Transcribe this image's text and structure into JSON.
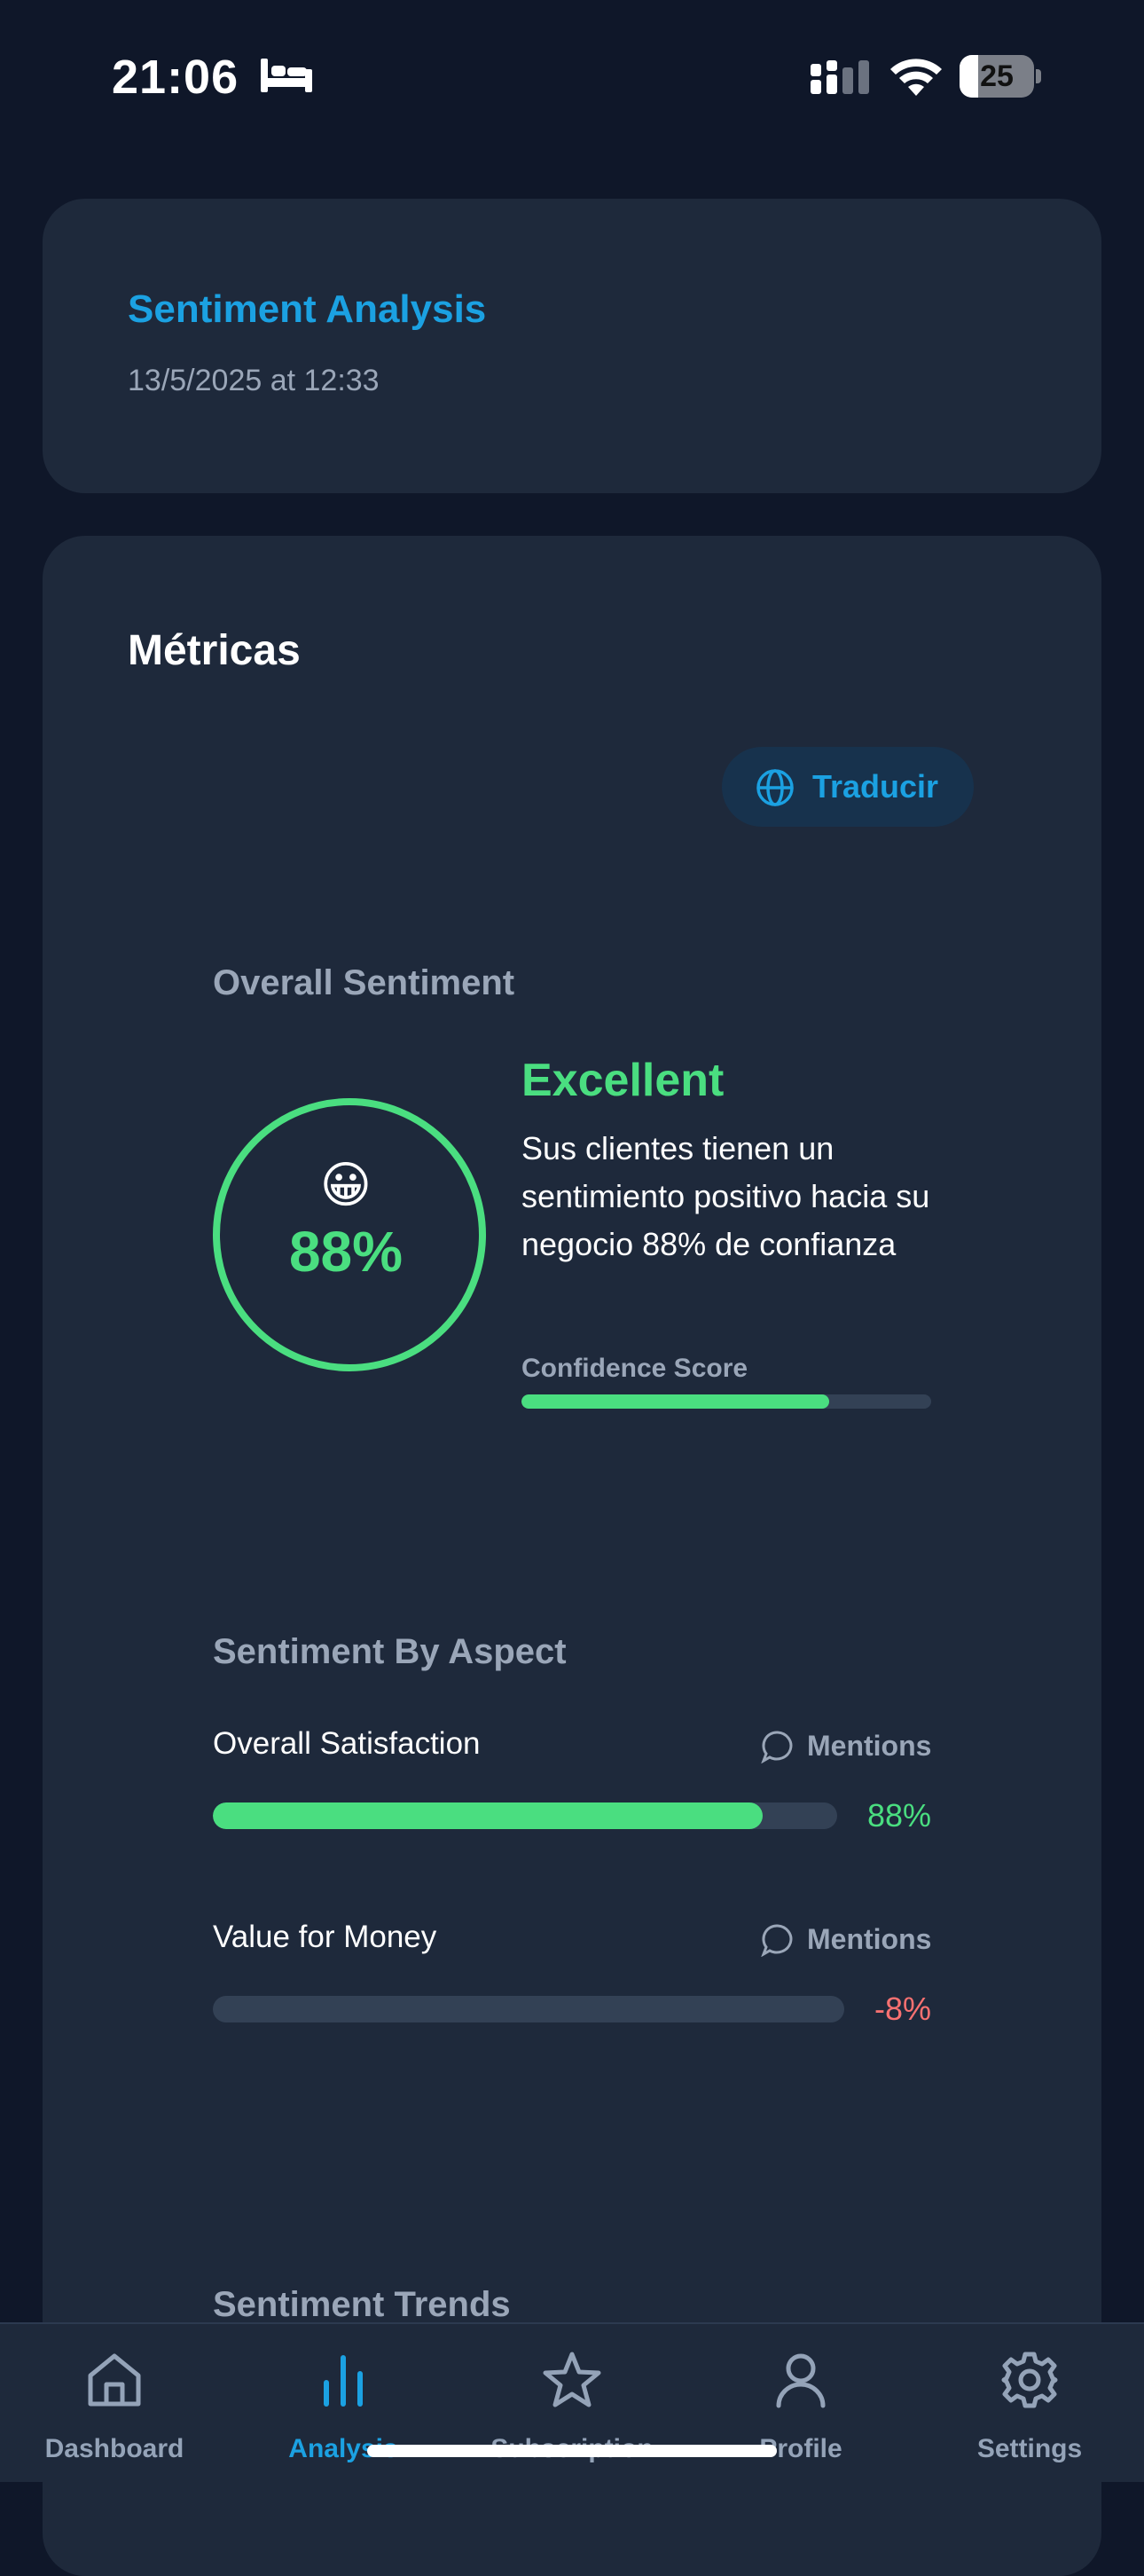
{
  "status_bar": {
    "time": "21:06",
    "battery_level": "25",
    "battery_fraction": 0.25,
    "icons": [
      "bed-icon",
      "signal-icon",
      "wifi-icon",
      "battery-icon"
    ]
  },
  "header": {
    "title": "Sentiment Analysis",
    "date": "13/5/2025 at 12:33"
  },
  "metrics": {
    "title": "Métricas",
    "translate_button": {
      "label": "Traducir",
      "icon": "globe-icon"
    },
    "overall": {
      "label": "Overall Sentiment",
      "emoji": "😀",
      "score_text": "88%",
      "level": "Excellent",
      "description": "Sus clientes tienen un sentimiento positivo hacia su negocio 88% de confianza",
      "confidence_label": "Confidence Score",
      "confidence_value": 0.75
    },
    "by_aspect": {
      "label": "Sentiment By Aspect",
      "items": [
        {
          "name": "Overall  Satisfaction",
          "mentions_label": "Mentions",
          "value_text": "88%",
          "value": 0.88,
          "color": "#4ade80"
        },
        {
          "name": "Value for  Money",
          "mentions_label": "Mentions",
          "value_text": "-8%",
          "value": 0,
          "color": "#f87171"
        }
      ]
    },
    "trends": {
      "label": "Sentiment Trends"
    }
  },
  "nav": {
    "items": [
      {
        "label": "Dashboard",
        "icon": "home-icon",
        "active": false
      },
      {
        "label": "Analysis",
        "icon": "bar-chart-icon",
        "active": true
      },
      {
        "label": "Subscription",
        "icon": "star-icon",
        "active": false
      },
      {
        "label": "Profile",
        "icon": "user-icon",
        "active": false
      },
      {
        "label": "Settings",
        "icon": "gear-icon",
        "active": false
      }
    ]
  },
  "colors": {
    "background": "#0f1729",
    "card": "#1e293b",
    "accent": "#1ba1e2",
    "positive": "#4ade80",
    "negative": "#f87171",
    "muted": "#9aa6b8"
  }
}
